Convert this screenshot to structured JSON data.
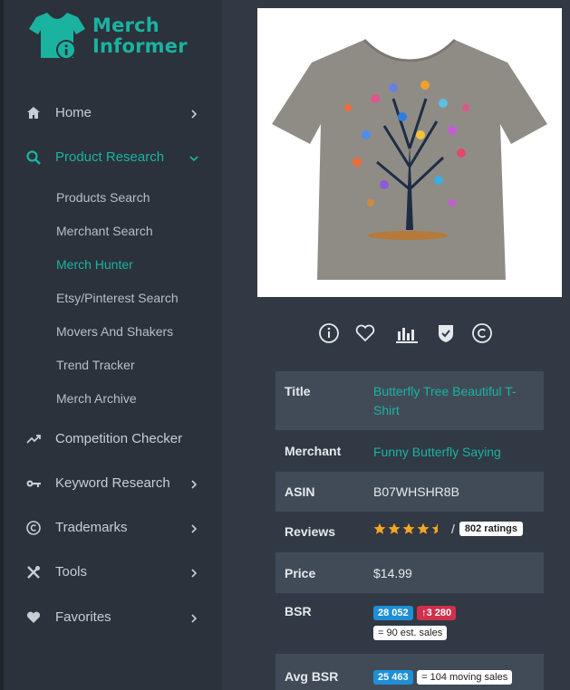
{
  "brand": {
    "line1": "Merch",
    "line2": "Informer"
  },
  "sidebar": {
    "items": [
      {
        "label": "Home"
      },
      {
        "label": "Product Research"
      },
      {
        "label": "Competition Checker"
      },
      {
        "label": "Keyword Research"
      },
      {
        "label": "Trademarks"
      },
      {
        "label": "Tools"
      },
      {
        "label": "Favorites"
      }
    ],
    "sub": [
      {
        "label": "Products Search"
      },
      {
        "label": "Merchant Search"
      },
      {
        "label": "Merch Hunter"
      },
      {
        "label": "Etsy/Pinterest Search"
      },
      {
        "label": "Movers And Shakers"
      },
      {
        "label": "Trend Tracker"
      },
      {
        "label": "Merch Archive"
      }
    ]
  },
  "product": {
    "title_key": "Title",
    "title": "Butterfly Tree Beautiful T-Shirt",
    "merchant_key": "Merchant",
    "merchant": "Funny Butterfly Saying",
    "asin_key": "ASIN",
    "asin": "B07WHSHR8B",
    "reviews_key": "Reviews",
    "rating": 4.5,
    "ratings_label": "802 ratings",
    "price_key": "Price",
    "price": "$14.99",
    "bsr_key": "BSR",
    "bsr": "28 052",
    "bsr_change": "3 280",
    "est_sales": "= 90 est. sales",
    "avg_bsr_key": "Avg BSR",
    "avg_bsr": "25 463",
    "moving_sales": "= 104 moving sales"
  },
  "colors": {
    "accent": "#1ab3a0",
    "sidebar_bg": "#2b323b",
    "main_bg": "#313944",
    "row_shade": "#414b58",
    "bsr_blue": "#1e8fd6",
    "bsr_red": "#d0304a",
    "star": "#f5a623"
  },
  "icons": {
    "logo": "tshirt-info-icon",
    "home": "home-icon",
    "research": "search-icon",
    "competition": "trending-icon",
    "keyword": "key-icon",
    "trademarks": "copyright-icon",
    "tools": "tools-icon",
    "favorites": "heart-icon",
    "actions": [
      "info-icon",
      "heart-icon",
      "chart-icon",
      "shield-check-icon",
      "copyright-icon"
    ]
  }
}
